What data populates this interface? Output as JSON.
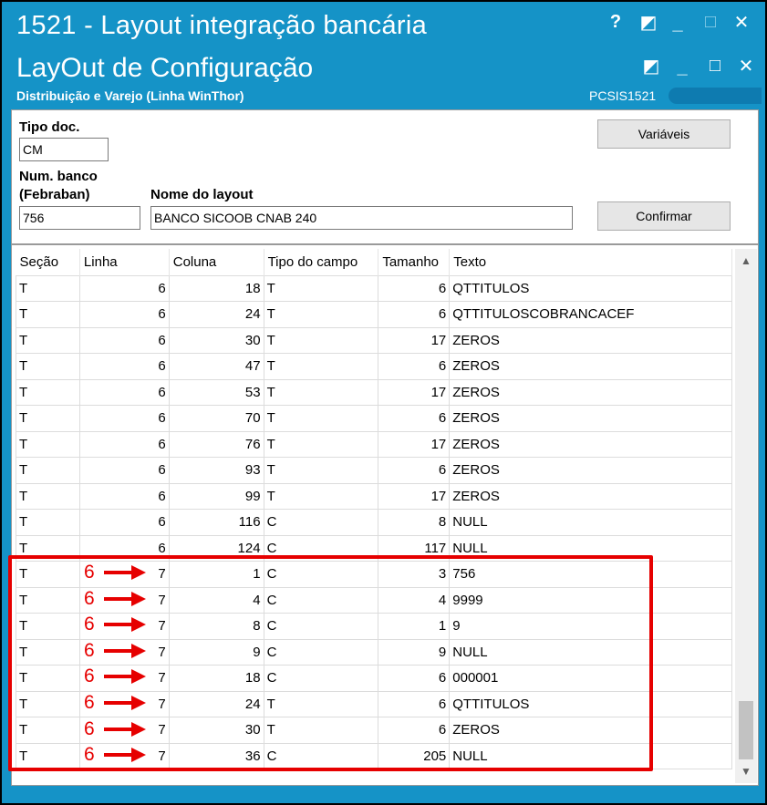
{
  "window": {
    "title": "1521 - Layout integração bancária",
    "controls": [
      "?",
      "◩",
      "_",
      "□",
      "✕"
    ]
  },
  "subwindow": {
    "title": "LayOut de Configuração",
    "subtitle": "Distribuição e Varejo (Linha WinThor)",
    "code": "PCSIS1521"
  },
  "form": {
    "tipo_doc_label": "Tipo doc.",
    "tipo_doc_value": "CM",
    "num_banco_label_1": "Num. banco",
    "num_banco_label_2": "(Febraban)",
    "num_banco_value": "756",
    "nome_layout_label": "Nome do layout",
    "nome_layout_value": "BANCO SICOOB CNAB 240",
    "variaveis_label": "Variáveis",
    "confirmar_label": "Confirmar"
  },
  "grid": {
    "headers": [
      "Seção",
      "Linha",
      "Coluna",
      "Tipo do campo",
      "Tamanho",
      "Texto"
    ],
    "rows": [
      [
        "T",
        "6",
        "18",
        "T",
        "6",
        "QTTITULOS"
      ],
      [
        "T",
        "6",
        "24",
        "T",
        "6",
        "QTTITULOSCOBRANCACEF"
      ],
      [
        "T",
        "6",
        "30",
        "T",
        "17",
        "ZEROS"
      ],
      [
        "T",
        "6",
        "47",
        "T",
        "6",
        "ZEROS"
      ],
      [
        "T",
        "6",
        "53",
        "T",
        "17",
        "ZEROS"
      ],
      [
        "T",
        "6",
        "70",
        "T",
        "6",
        "ZEROS"
      ],
      [
        "T",
        "6",
        "76",
        "T",
        "17",
        "ZEROS"
      ],
      [
        "T",
        "6",
        "93",
        "T",
        "6",
        "ZEROS"
      ],
      [
        "T",
        "6",
        "99",
        "T",
        "17",
        "ZEROS"
      ],
      [
        "T",
        "6",
        "116",
        "C",
        "8",
        "NULL"
      ],
      [
        "T",
        "6",
        "124",
        "C",
        "117",
        "NULL"
      ],
      [
        "T",
        "7",
        "1",
        "C",
        "3",
        "756"
      ],
      [
        "T",
        "7",
        "4",
        "C",
        "4",
        "9999"
      ],
      [
        "T",
        "7",
        "8",
        "C",
        "1",
        "9"
      ],
      [
        "T",
        "7",
        "9",
        "C",
        "9",
        "NULL"
      ],
      [
        "T",
        "7",
        "18",
        "C",
        "6",
        "000001"
      ],
      [
        "T",
        "7",
        "24",
        "T",
        "6",
        "QTTITULOS"
      ],
      [
        "T",
        "7",
        "30",
        "T",
        "6",
        "ZEROS"
      ],
      [
        "T",
        "7",
        "36",
        "C",
        "205",
        "NULL"
      ]
    ],
    "annotation_old_value": "6",
    "annotated_rows_start": 11
  },
  "colors": {
    "titlebar": "#1593c7",
    "highlight": "#e60000"
  },
  "icons": {
    "scroll_up": "▲",
    "scroll_down": "▼"
  }
}
